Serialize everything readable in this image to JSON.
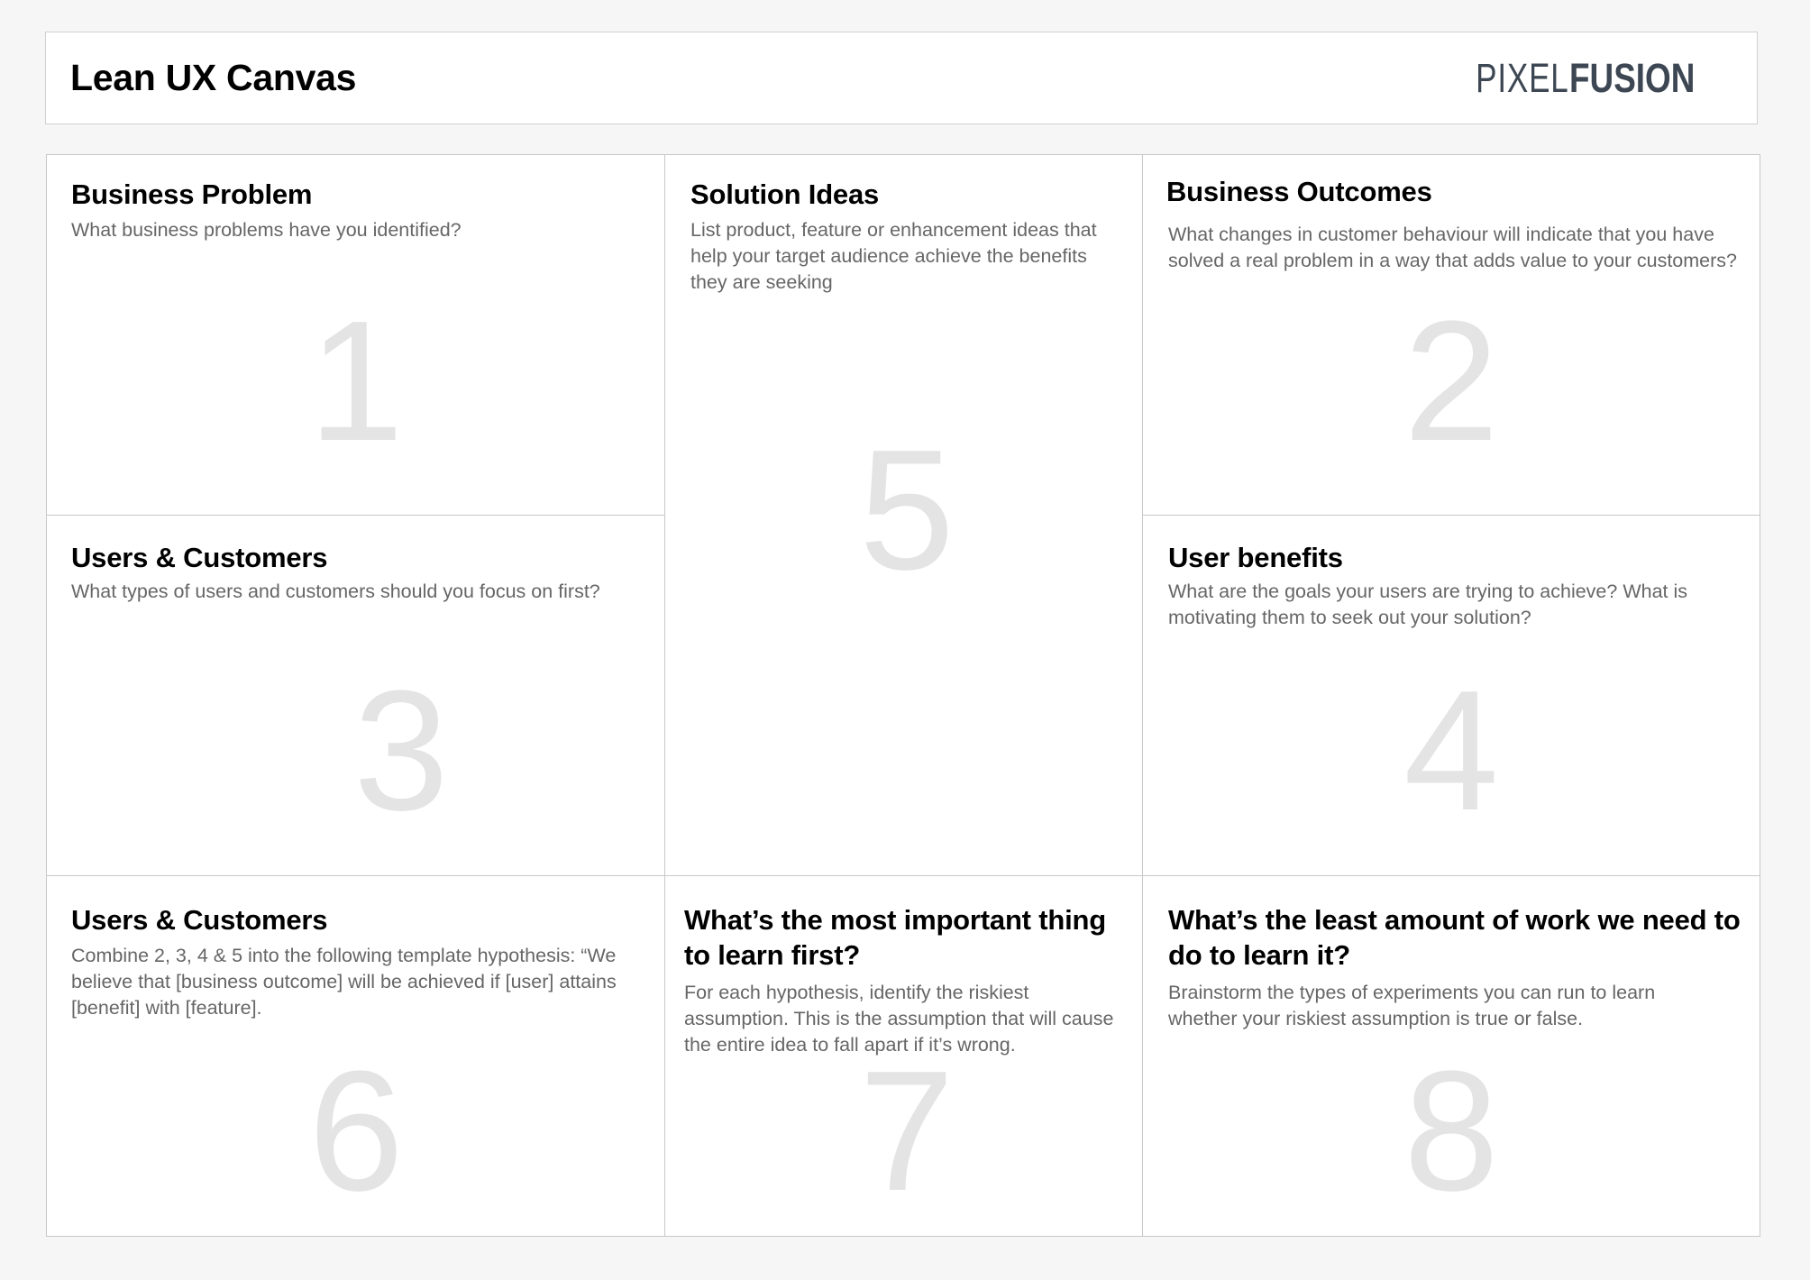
{
  "header": {
    "title": "Lean UX Canvas",
    "logo_light": "PIXEL",
    "logo_bold": "FUSION",
    "logo_color": "#3d4753"
  },
  "cells": [
    {
      "title": "Business Problem",
      "description": "What business problems have you identified?",
      "number": "1"
    },
    {
      "title": "Solution Ideas",
      "description": "List product, feature or enhancement ideas that help your target audience achieve the benefits they are seeking",
      "number": "5"
    },
    {
      "title": "Business Outcomes",
      "description": "What changes in customer behaviour will indicate that you have solved a real problem in a way that adds value to your customers?",
      "number": "2"
    },
    {
      "title": "Users & Customers",
      "description": "What types of users and customers should you focus on first?",
      "number": "3"
    },
    {
      "title": "User benefits",
      "description": "What are the goals your users are trying to achieve?  What is motivating them to seek out your solution?",
      "number": "4"
    },
    {
      "title": "Users & Customers",
      "description": "Combine 2, 3, 4 & 5 into the following template hypothesis: “We believe that [business outcome] will be achieved if [user] attains [benefit] with [feature].",
      "number": "6"
    },
    {
      "title": "What’s the most important thing to learn first?",
      "description": "For each hypothesis, identify the riskiest assumption.  This is the assumption that will cause the entire idea to fall apart if it’s wrong.",
      "number": "7"
    },
    {
      "title": "What’s the least amount of work we need to do to learn it?",
      "description": "Brainstorm the types of experiments you can run to learn whether your riskiest assumption is true or false.",
      "number": "8"
    }
  ]
}
